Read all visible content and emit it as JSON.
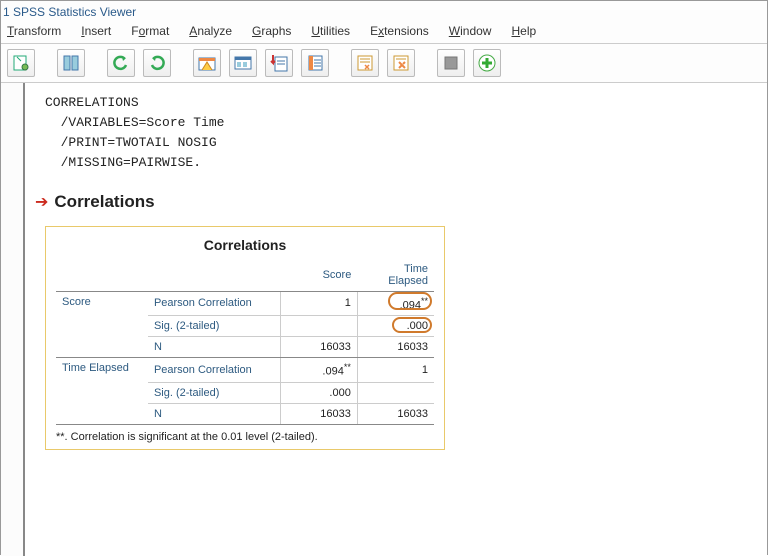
{
  "window": {
    "title": "1 SPSS Statistics Viewer"
  },
  "menu": {
    "transform": "Transform",
    "insert": "Insert",
    "format": "Format",
    "analyze": "Analyze",
    "graphs": "Graphs",
    "utilities": "Utilities",
    "extensions": "Extensions",
    "window": "Window",
    "help": "Help"
  },
  "syntax": {
    "l1": "CORRELATIONS",
    "l2": "  /VARIABLES=Score Time",
    "l3": "  /PRINT=TWOTAIL NOSIG",
    "l4": "  /MISSING=PAIRWISE."
  },
  "section": {
    "title": "Correlations"
  },
  "pivot": {
    "title": "Correlations",
    "col1": "Score",
    "col2": "Time Elapsed",
    "var1": "Score",
    "var2": "Time Elapsed",
    "stat_pearson": "Pearson Correlation",
    "stat_sig": "Sig. (2-tailed)",
    "stat_n": "N",
    "r1_pearson_c1": "1",
    "r1_pearson_c2": ".094",
    "r1_pearson_c2_sup": "**",
    "r1_sig_c1": "",
    "r1_sig_c2": ".000",
    "r1_n_c1": "16033",
    "r1_n_c2": "16033",
    "r2_pearson_c1": ".094",
    "r2_pearson_c1_sup": "**",
    "r2_pearson_c2": "1",
    "r2_sig_c1": ".000",
    "r2_sig_c2": "",
    "r2_n_c1": "16033",
    "r2_n_c2": "16033",
    "footnote": "**. Correlation is significant at the 0.01 level (2-tailed)."
  },
  "chart_data": {
    "type": "table",
    "title": "Correlations",
    "variables": [
      "Score",
      "Time Elapsed"
    ],
    "statistics": [
      "Pearson Correlation",
      "Sig. (2-tailed)",
      "N"
    ],
    "matrix": {
      "Score": {
        "Score": {
          "pearson": 1,
          "sig": null,
          "n": 16033
        },
        "Time Elapsed": {
          "pearson": 0.094,
          "sig": 0.0,
          "n": 16033,
          "sig_flag": "**"
        }
      },
      "Time Elapsed": {
        "Score": {
          "pearson": 0.094,
          "sig": 0.0,
          "n": 16033,
          "sig_flag": "**"
        },
        "Time Elapsed": {
          "pearson": 1,
          "sig": null,
          "n": 16033
        }
      }
    },
    "footnote": "**. Correlation is significant at the 0.01 level (2-tailed)."
  }
}
